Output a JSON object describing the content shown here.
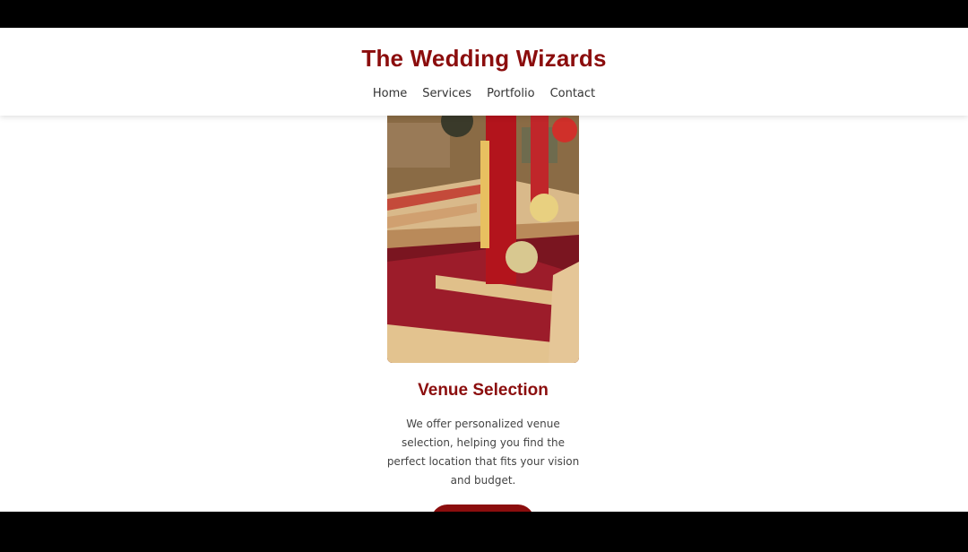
{
  "header": {
    "title": "The Wedding Wizards",
    "nav": [
      "Home",
      "Services",
      "Portfolio",
      "Contact"
    ]
  },
  "service_card": {
    "image_description": "Decorated mandap with red rose petals and flower pillars",
    "title": "Venue Selection",
    "description": "We offer personalized venue selection, helping you find the perfect location that fits your vision and budget.",
    "button_label": ""
  },
  "colors": {
    "brand": "#8b0d0d",
    "text": "#444444",
    "nav_text": "#333333",
    "background": "#ffffff",
    "letterbox": "#000000"
  }
}
